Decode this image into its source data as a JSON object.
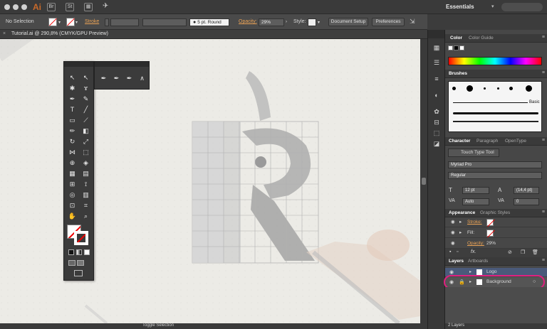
{
  "menubar": {
    "workspace": "Essentials",
    "app_logo": "Ai"
  },
  "control_bar": {
    "selection": "No Selection",
    "stroke_label": "Stroke",
    "brush": "5 pt. Round",
    "opacity_label": "Opacity:",
    "opacity_value": "29%",
    "style_label": "Style:",
    "doc_setup": "Document Setup",
    "preferences": "Preferences"
  },
  "document": {
    "tab_title": "Tutorial.ai @ 290,8% (CMYK/GPU Preview)"
  },
  "status_bar": {
    "tool": "Toggle Selection"
  },
  "color_panel": {
    "tabs": [
      "Color",
      "Color Guide"
    ]
  },
  "brushes_panel": {
    "title": "Brushes",
    "basic_label": "Basic"
  },
  "character_panel": {
    "tabs": [
      "Character",
      "Paragraph",
      "OpenType"
    ],
    "touch_type": "Touch Type Tool",
    "font_family": "Myriad Pro",
    "font_style": "Regular",
    "size": "12 pt",
    "leading": "(14,4 pt)",
    "kerning": "Auto",
    "tracking": "0"
  },
  "appearance_panel": {
    "tabs": [
      "Appearance",
      "Graphic Styles"
    ],
    "stroke_label": "Stroke:",
    "fill_label": "Fill:",
    "opacity_label": "Opacity:",
    "opacity_value": "29%",
    "fx_label": "fx."
  },
  "layers_panel": {
    "tabs": [
      "Layers",
      "Artboards"
    ],
    "layers": [
      {
        "name": "Logo"
      },
      {
        "name": "Background"
      }
    ],
    "count": "2 Layers"
  },
  "colors": {
    "highlight": "#e0207f",
    "accent": "#c96a2a"
  }
}
